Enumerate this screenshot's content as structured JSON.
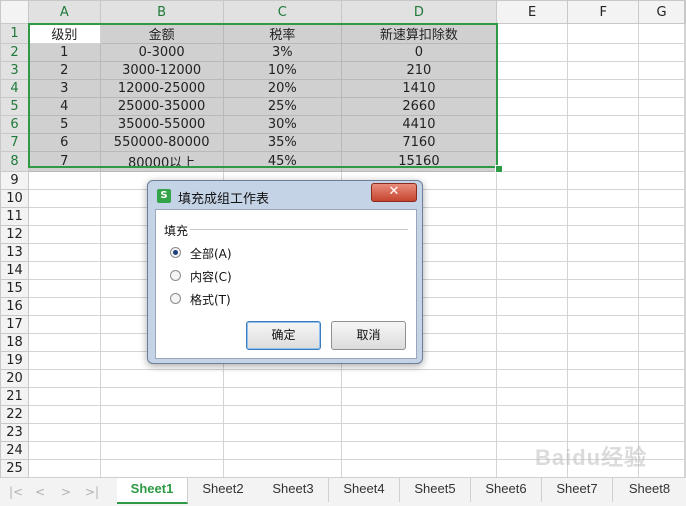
{
  "columns": [
    "A",
    "B",
    "C",
    "D",
    "E",
    "F",
    "G"
  ],
  "rows": [
    [
      "级别",
      "金额",
      "税率",
      "新速算扣除数"
    ],
    [
      "1",
      "0-3000",
      "3%",
      "0"
    ],
    [
      "2",
      "3000-12000",
      "10%",
      "210"
    ],
    [
      "3",
      "12000-25000",
      "20%",
      "1410"
    ],
    [
      "4",
      "25000-35000",
      "25%",
      "2660"
    ],
    [
      "5",
      "35000-55000",
      "30%",
      "4410"
    ],
    [
      "6",
      "550000-80000",
      "35%",
      "7160"
    ],
    [
      "7",
      "80000以上",
      "45%",
      "15160"
    ]
  ],
  "row_numbers": [
    "1",
    "2",
    "3",
    "4",
    "5",
    "6",
    "7",
    "8",
    "9",
    "10",
    "11",
    "12",
    "13",
    "14",
    "15",
    "16",
    "17",
    "18",
    "19",
    "20",
    "21",
    "22",
    "23",
    "24",
    "25"
  ],
  "dialog": {
    "title": "填充成组工作表",
    "app_icon_letter": "S",
    "close_glyph": "✕",
    "group_label": "填充",
    "options": [
      {
        "label": "全部(A)",
        "selected": true
      },
      {
        "label": "内容(C)",
        "selected": false
      },
      {
        "label": "格式(T)",
        "selected": false
      }
    ],
    "ok_label": "确定",
    "cancel_label": "取消"
  },
  "tabs": [
    "Sheet1",
    "Sheet2",
    "Sheet3",
    "Sheet4",
    "Sheet5",
    "Sheet6",
    "Sheet7",
    "Sheet8"
  ],
  "active_tab": "Sheet1",
  "nav_buttons": [
    "|<",
    "<",
    ">",
    ">|"
  ],
  "watermark": "Baidu经验",
  "colors": {
    "selection": "#2f9a45",
    "fill": "#d0d0d0",
    "dialog_frame": "#c5d3e6"
  }
}
